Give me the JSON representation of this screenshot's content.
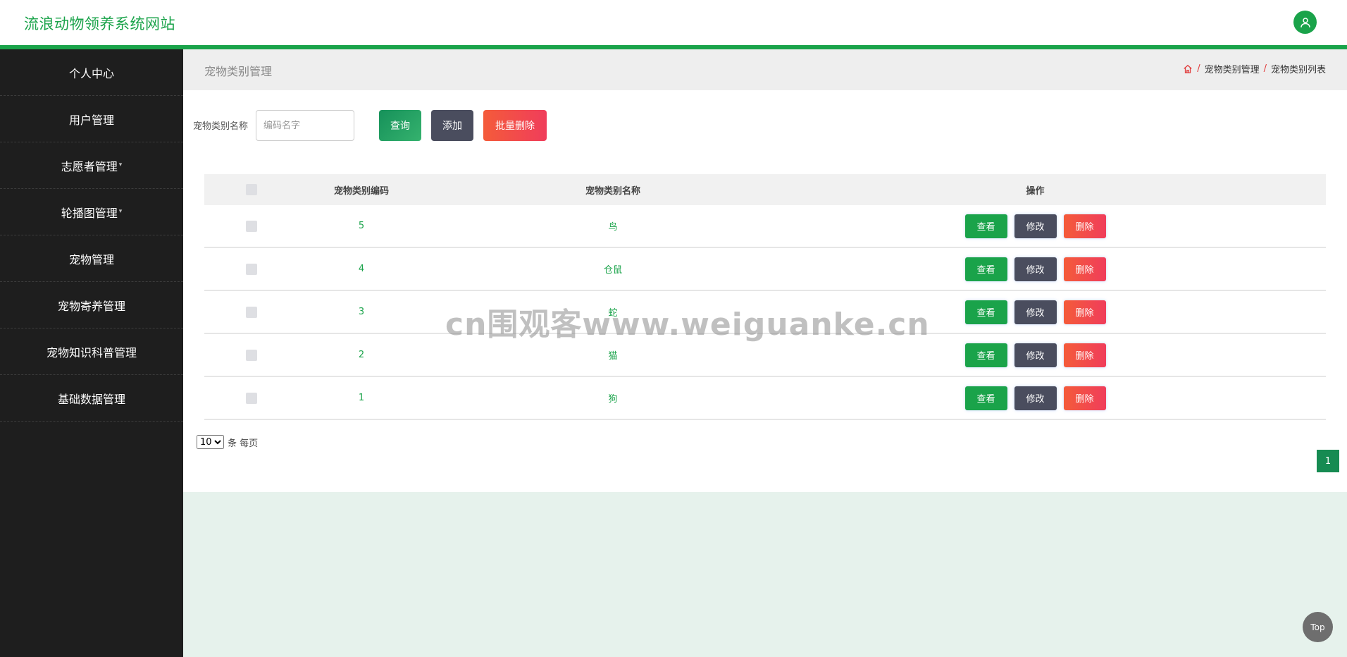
{
  "header": {
    "site_title": "流浪动物领养系统网站",
    "avatar_icon": "user-icon"
  },
  "sidebar": {
    "items": [
      {
        "label": "个人中心",
        "has_caret": false
      },
      {
        "label": "用户管理",
        "has_caret": false
      },
      {
        "label": "志愿者管理",
        "has_caret": true
      },
      {
        "label": "轮播图管理",
        "has_caret": true
      },
      {
        "label": "宠物管理",
        "has_caret": false
      },
      {
        "label": "宠物寄养管理",
        "has_caret": false
      },
      {
        "label": "宠物知识科普管理",
        "has_caret": false
      },
      {
        "label": "基础数据管理",
        "has_caret": false
      }
    ]
  },
  "page": {
    "title": "宠物类别管理",
    "breadcrumb": [
      "宠物类别管理",
      "宠物类别列表"
    ]
  },
  "search": {
    "label": "宠物类别名称",
    "placeholder": "编码名字",
    "query_label": "查询",
    "add_label": "添加",
    "batch_delete_label": "批量删除"
  },
  "table": {
    "headers": {
      "code": "宠物类别编码",
      "name": "宠物类别名称",
      "ops": "操作"
    },
    "rows": [
      {
        "code": "5",
        "name": "鸟"
      },
      {
        "code": "4",
        "name": "仓鼠"
      },
      {
        "code": "3",
        "name": "蛇"
      },
      {
        "code": "2",
        "name": "猫"
      },
      {
        "code": "1",
        "name": "狗"
      }
    ],
    "row_actions": {
      "view": "查看",
      "edit": "修改",
      "delete": "删除"
    }
  },
  "pagination": {
    "page_size": "10",
    "page_size_suffix": "条 每页",
    "current_page": "1"
  },
  "watermark": "cn围观客www.weiguanke.cn",
  "back_to_top": "Top",
  "colors": {
    "accent": "#1aa34a",
    "danger": "#f03d5b",
    "dark": "#4a4d5e",
    "sidebar": "#1e1e1e"
  }
}
